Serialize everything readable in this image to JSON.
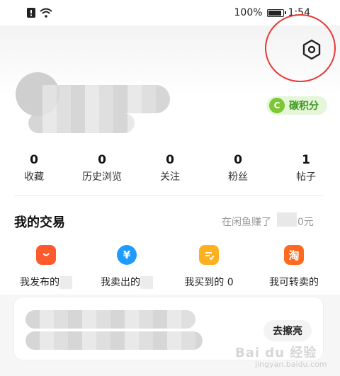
{
  "status_bar": {
    "battery_text": "100%",
    "time": "1:54",
    "battery_level": 0.95
  },
  "header": {
    "settings_icon": "hex-settings-icon"
  },
  "profile": {
    "carbon_badge": {
      "icon_letter": "C",
      "label": "碳积分",
      "color": "#7cc734"
    }
  },
  "stats": [
    {
      "value": "0",
      "label": "收藏"
    },
    {
      "value": "0",
      "label": "历史浏览"
    },
    {
      "value": "0",
      "label": "关注"
    },
    {
      "value": "0",
      "label": "粉丝"
    },
    {
      "value": "1",
      "label": "帖子"
    }
  ],
  "trade": {
    "title": "我的交易",
    "earn_prefix": "在闲鱼赚了",
    "earn_suffix": "00元",
    "items": [
      {
        "label": "我发布的",
        "icon": "bag-icon",
        "color": "#ff5a2c"
      },
      {
        "label": "我卖出的",
        "icon": "yen-icon",
        "color": "#1e9bff"
      },
      {
        "label": "我买到的 0",
        "icon": "order-check-icon",
        "color": "#ffb020"
      },
      {
        "label": "我可转卖的",
        "icon": "tao-icon",
        "color": "#ff6a1f"
      }
    ]
  },
  "card": {
    "button_label": "去擦亮"
  },
  "watermark": {
    "text": "Bai du 经验",
    "sub": "jingyan.baidu.com"
  },
  "colors": {
    "highlight_circle": "#e53935"
  }
}
